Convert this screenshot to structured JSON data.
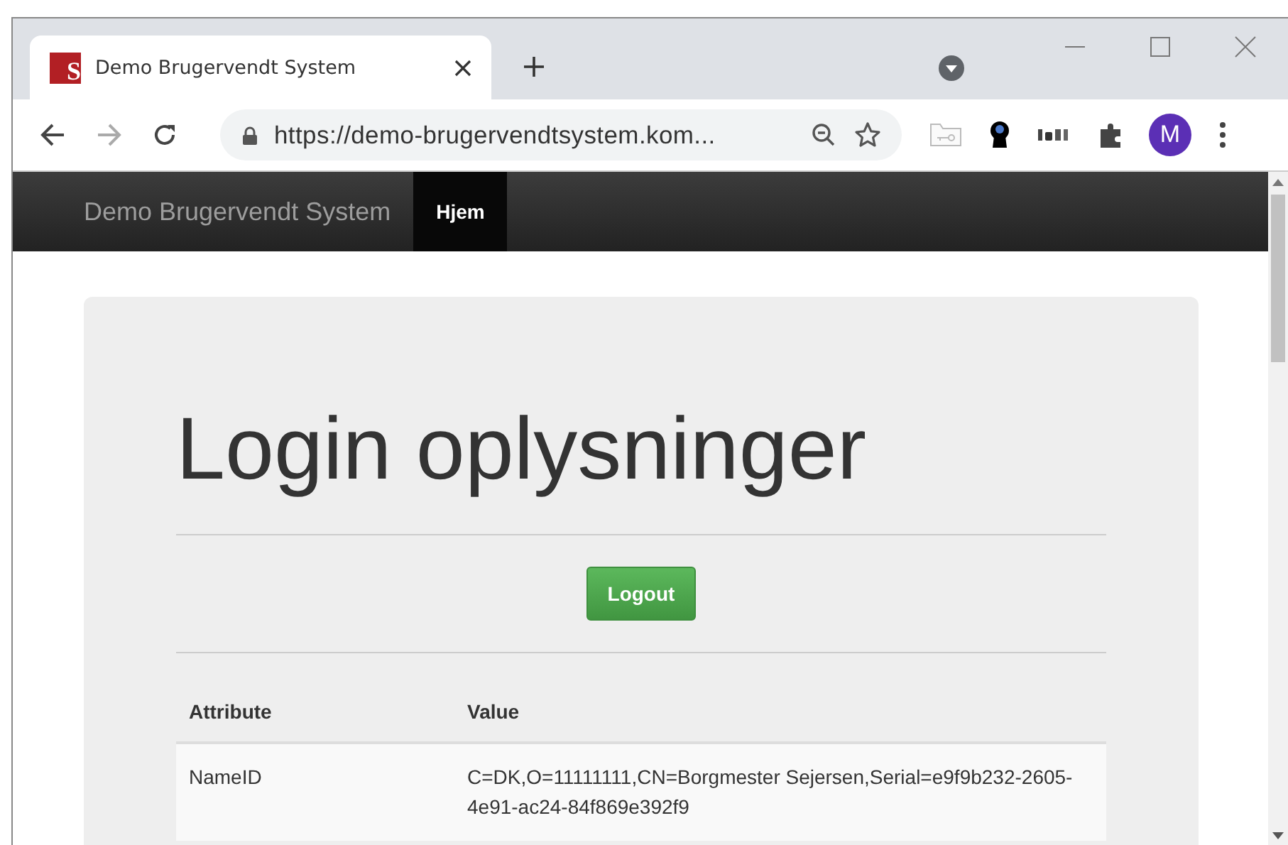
{
  "browser": {
    "tab": {
      "favicon_letter": "S",
      "title": "Demo Brugervendt System"
    },
    "address": "https://demo-brugervendtsystem.kom...",
    "avatar": "M"
  },
  "navbar": {
    "brand": "Demo Brugervendt System",
    "links": [
      {
        "label": "Hjem",
        "selected": true
      }
    ]
  },
  "page": {
    "heading": "Login oplysninger",
    "logout": "Logout",
    "table": {
      "columns": [
        "Attribute",
        "Value"
      ],
      "rows": [
        {
          "attribute": "NameID",
          "value": "C=DK,O=11111111,CN=Borgmester Sejersen,Serial=e9f9b232-2605-4e91-ac24-84f869e392f9"
        }
      ]
    }
  }
}
